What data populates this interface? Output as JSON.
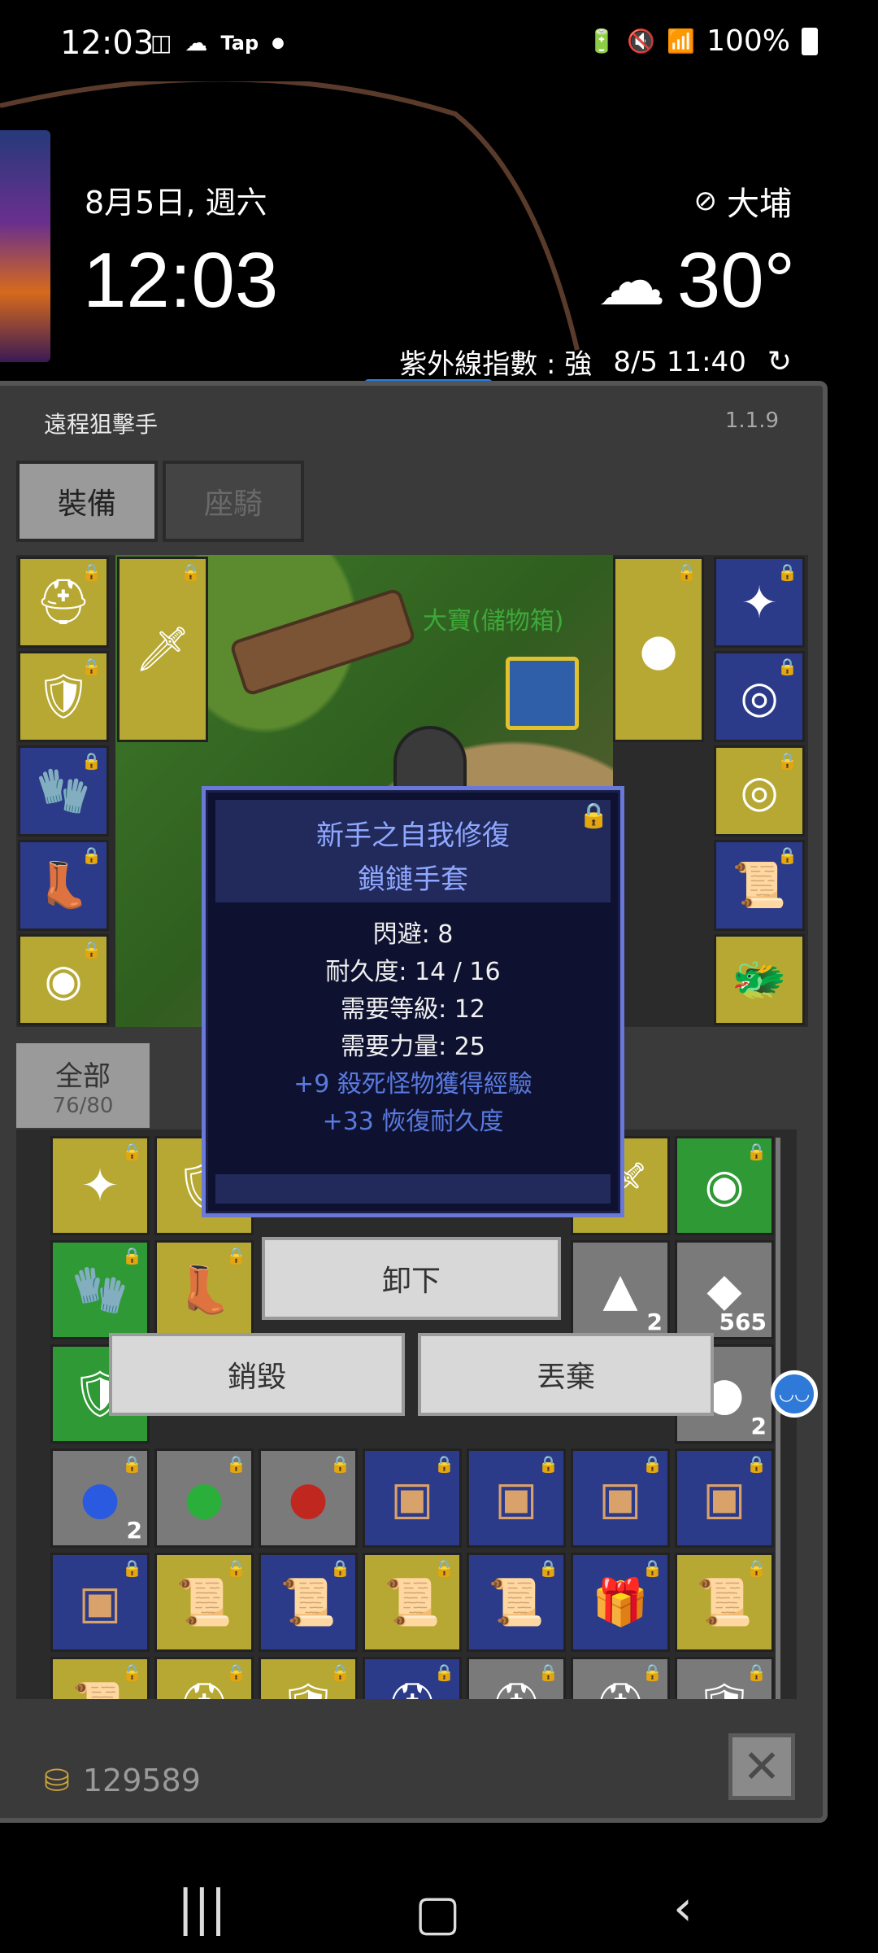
{
  "status_bar": {
    "time": "12:03",
    "left_icons": [
      "camera-icon",
      "sun-cloud-icon"
    ],
    "tap_label": "Tap",
    "battery": "100%"
  },
  "lockscreen": {
    "date": "8月5日, 週六",
    "clock": "12:03",
    "location": "大埔",
    "temperature": "30°",
    "uv": "紫外線指數 : 強",
    "updated": "8/5 11:40"
  },
  "game": {
    "title": "遠程狙擊手",
    "version": "1.1.9",
    "tabs": [
      {
        "label": "裝備",
        "active": true
      },
      {
        "label": "座騎",
        "active": false
      }
    ],
    "scene_label": "大寶(儲物箱)",
    "filter": {
      "label": "全部",
      "count": "76/80"
    },
    "gold": "129589",
    "grid_quantities": {
      "r1c6": "2",
      "r1c7": "565",
      "r2c7": "2",
      "r3c1": "2"
    }
  },
  "tooltip": {
    "title_line1": "新手之自我修復",
    "title_line2": "鎖鏈手套",
    "stats": [
      "閃避: 8",
      "耐久度: 14 / 16",
      "需要等級: 12",
      "需要力量: 25"
    ],
    "bonuses": [
      "+9 殺死怪物獲得經驗",
      "+33 恢復耐久度"
    ]
  },
  "actions": {
    "unequip": "卸下",
    "destroy": "銷毀",
    "discard": "丟棄"
  },
  "colors": {
    "panel_bg": "#3a3a3a",
    "tooltip_title": "#8fa8ff",
    "tooltip_bonus": "#5a7ae0",
    "slot_yellow": "#b6a832",
    "slot_blue": "#2c3a8a",
    "slot_green": "#2f9a35",
    "slot_gray": "#7a7a7a"
  }
}
